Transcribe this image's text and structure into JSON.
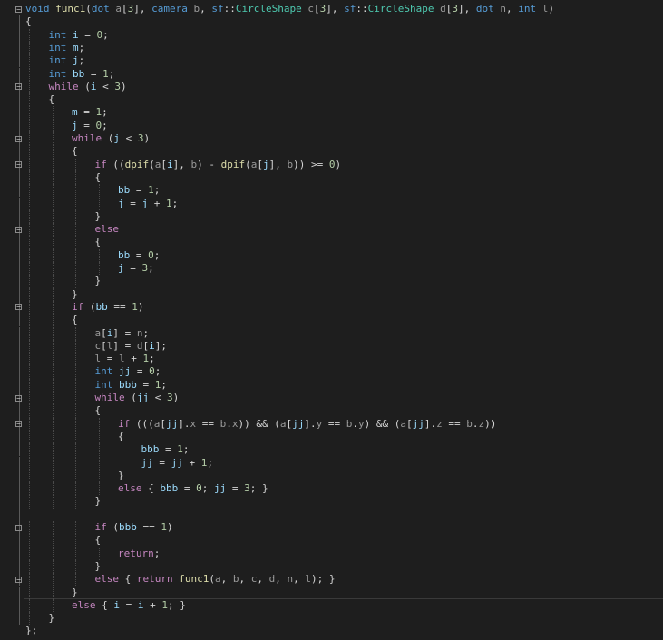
{
  "editor": {
    "lines": [
      {
        "indent": 0,
        "text": "void func1(dot a[3], camera b, sf::CircleShape c[3], sf::CircleShape d[3], dot n, int l)"
      },
      {
        "indent": 0,
        "text": "{"
      },
      {
        "indent": 1,
        "text": "int i = 0;"
      },
      {
        "indent": 1,
        "text": "int m;"
      },
      {
        "indent": 1,
        "text": "int j;"
      },
      {
        "indent": 1,
        "text": "int bb = 1;"
      },
      {
        "indent": 1,
        "text": "while (i < 3)"
      },
      {
        "indent": 1,
        "text": "{"
      },
      {
        "indent": 2,
        "text": "m = 1;"
      },
      {
        "indent": 2,
        "text": "j = 0;"
      },
      {
        "indent": 2,
        "text": "while (j < 3)"
      },
      {
        "indent": 2,
        "text": "{"
      },
      {
        "indent": 3,
        "text": "if ((dpif(a[i], b) - dpif(a[j], b)) >= 0)"
      },
      {
        "indent": 3,
        "text": "{"
      },
      {
        "indent": 4,
        "text": "bb = 1;"
      },
      {
        "indent": 4,
        "text": "j = j + 1;"
      },
      {
        "indent": 3,
        "text": "}"
      },
      {
        "indent": 3,
        "text": "else"
      },
      {
        "indent": 3,
        "text": "{"
      },
      {
        "indent": 4,
        "text": "bb = 0;"
      },
      {
        "indent": 4,
        "text": "j = 3;"
      },
      {
        "indent": 3,
        "text": "}"
      },
      {
        "indent": 2,
        "text": "}"
      },
      {
        "indent": 2,
        "text": "if (bb == 1)"
      },
      {
        "indent": 2,
        "text": "{"
      },
      {
        "indent": 3,
        "text": "a[i] = n;"
      },
      {
        "indent": 3,
        "text": "c[l] = d[i];"
      },
      {
        "indent": 3,
        "text": "l = l + 1;"
      },
      {
        "indent": 3,
        "text": "int jj = 0;"
      },
      {
        "indent": 3,
        "text": "int bbb = 1;"
      },
      {
        "indent": 3,
        "text": "while (jj < 3)"
      },
      {
        "indent": 3,
        "text": "{"
      },
      {
        "indent": 4,
        "text": "if (((a[jj].x == b.x)) && (a[jj].y == b.y) && (a[jj].z == b.z))"
      },
      {
        "indent": 4,
        "text": "{"
      },
      {
        "indent": 5,
        "text": "bbb = 1;"
      },
      {
        "indent": 5,
        "text": "jj = jj + 1;"
      },
      {
        "indent": 4,
        "text": "}"
      },
      {
        "indent": 4,
        "text": "else { bbb = 0; jj = 3; }"
      },
      {
        "indent": 3,
        "text": "}"
      },
      {
        "indent": 0,
        "text": ""
      },
      {
        "indent": 3,
        "text": "if (bbb == 1)"
      },
      {
        "indent": 3,
        "text": "{"
      },
      {
        "indent": 4,
        "text": "return;"
      },
      {
        "indent": 3,
        "text": "}"
      },
      {
        "indent": 3,
        "text": "else { return func1(a, b, c, d, n, l); }"
      },
      {
        "indent": 2,
        "text": "}"
      },
      {
        "indent": 2,
        "text": "else { i = i + 1; }"
      },
      {
        "indent": 1,
        "text": "}"
      },
      {
        "indent": 0,
        "text": "};"
      }
    ],
    "fold_lines": [
      0,
      6,
      10,
      12,
      17,
      23,
      30,
      32,
      40,
      44
    ],
    "current_line": 45
  },
  "colors": {
    "background": "#1e1e1e",
    "keyword": "#569cd6",
    "control": "#c586c0",
    "function": "#dcdcaa",
    "variable": "#9cdcfe",
    "parameter": "#9a9a9a",
    "number": "#b5cea8",
    "type": "#4ec9b0"
  }
}
